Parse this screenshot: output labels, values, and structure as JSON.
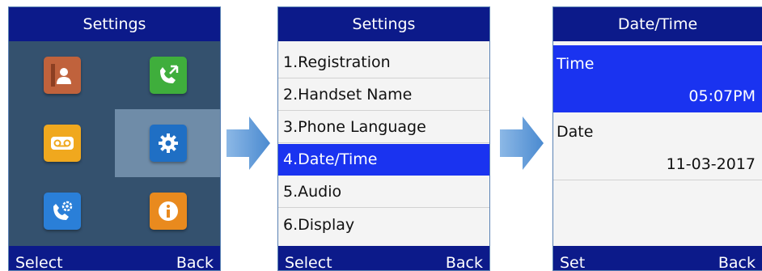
{
  "screen1": {
    "title": "Settings",
    "icons": [
      {
        "name": "contacts-icon",
        "color": "#c0623c"
      },
      {
        "name": "call-history-icon",
        "color": "#3fae3c"
      },
      {
        "name": "voicemail-icon",
        "color": "#f0a81e"
      },
      {
        "name": "settings-gear-icon",
        "color": "#1f6fc4"
      },
      {
        "name": "call-settings-icon",
        "color": "#2a7fd8"
      },
      {
        "name": "info-icon",
        "color": "#e98a1e"
      }
    ],
    "softkey_left": "Select",
    "softkey_right": "Back"
  },
  "screen2": {
    "title": "Settings",
    "items": [
      {
        "label": "1.Registration"
      },
      {
        "label": "2.Handset Name"
      },
      {
        "label": "3.Phone Language"
      },
      {
        "label": "4.Date/Time",
        "selected": true
      },
      {
        "label": "5.Audio"
      },
      {
        "label": "6.Display"
      }
    ],
    "softkey_left": "Select",
    "softkey_right": "Back"
  },
  "screen3": {
    "title": "Date/Time",
    "time_label": "Time",
    "time_value": "05:07PM",
    "date_label": "Date",
    "date_value": "11-03-2017",
    "softkey_left": "Set",
    "softkey_right": "Back"
  },
  "colors": {
    "bar": "#0c1a8a",
    "highlight": "#1a33f0",
    "arrow": "#5b9bd5"
  }
}
